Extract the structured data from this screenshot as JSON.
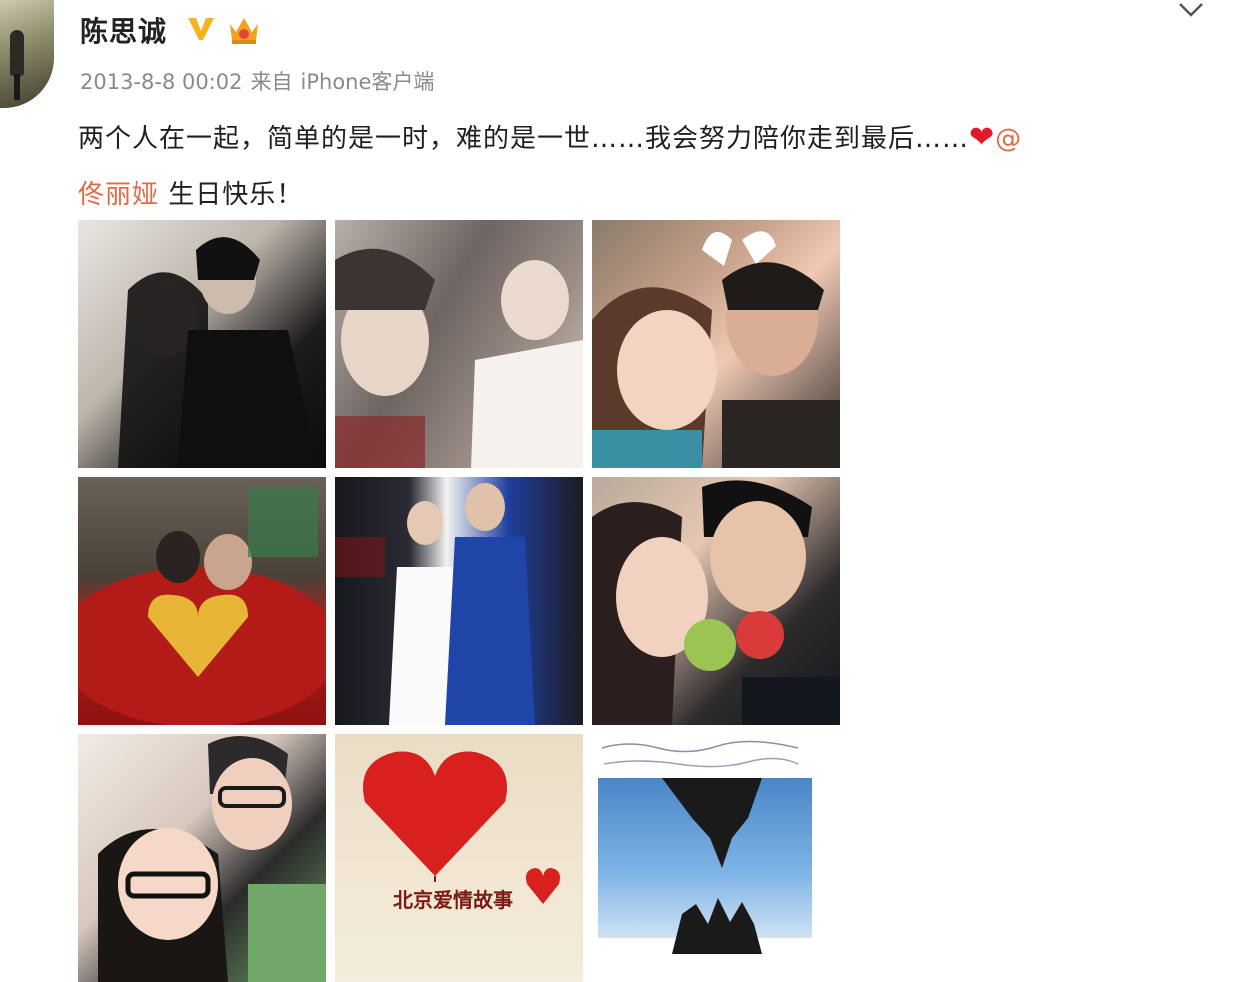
{
  "user": {
    "name": "陈思诚",
    "verified_icon": "verified-v-icon",
    "vip_icon": "vip-crown-icon"
  },
  "post": {
    "timestamp": "2013-8-8 00:02",
    "source_prefix": "来自",
    "source": "iPhone客户端",
    "text_line1": "两个人在一起，简单的是一时，难的是一世……我会努力陪你走到最后……",
    "heart": "❤",
    "at": "@",
    "mention": "佟丽娅",
    "text_line2_suffix": " 生日快乐！"
  },
  "gallery": {
    "photo_count": 9,
    "poster_caption": "北京爱情故事"
  },
  "menu_icon": "chevron-down-icon",
  "colors": {
    "mention": "#e06b47",
    "heart": "#e0192b",
    "meta": "#8a8a8a",
    "vip_gold": "#f0a21e"
  }
}
